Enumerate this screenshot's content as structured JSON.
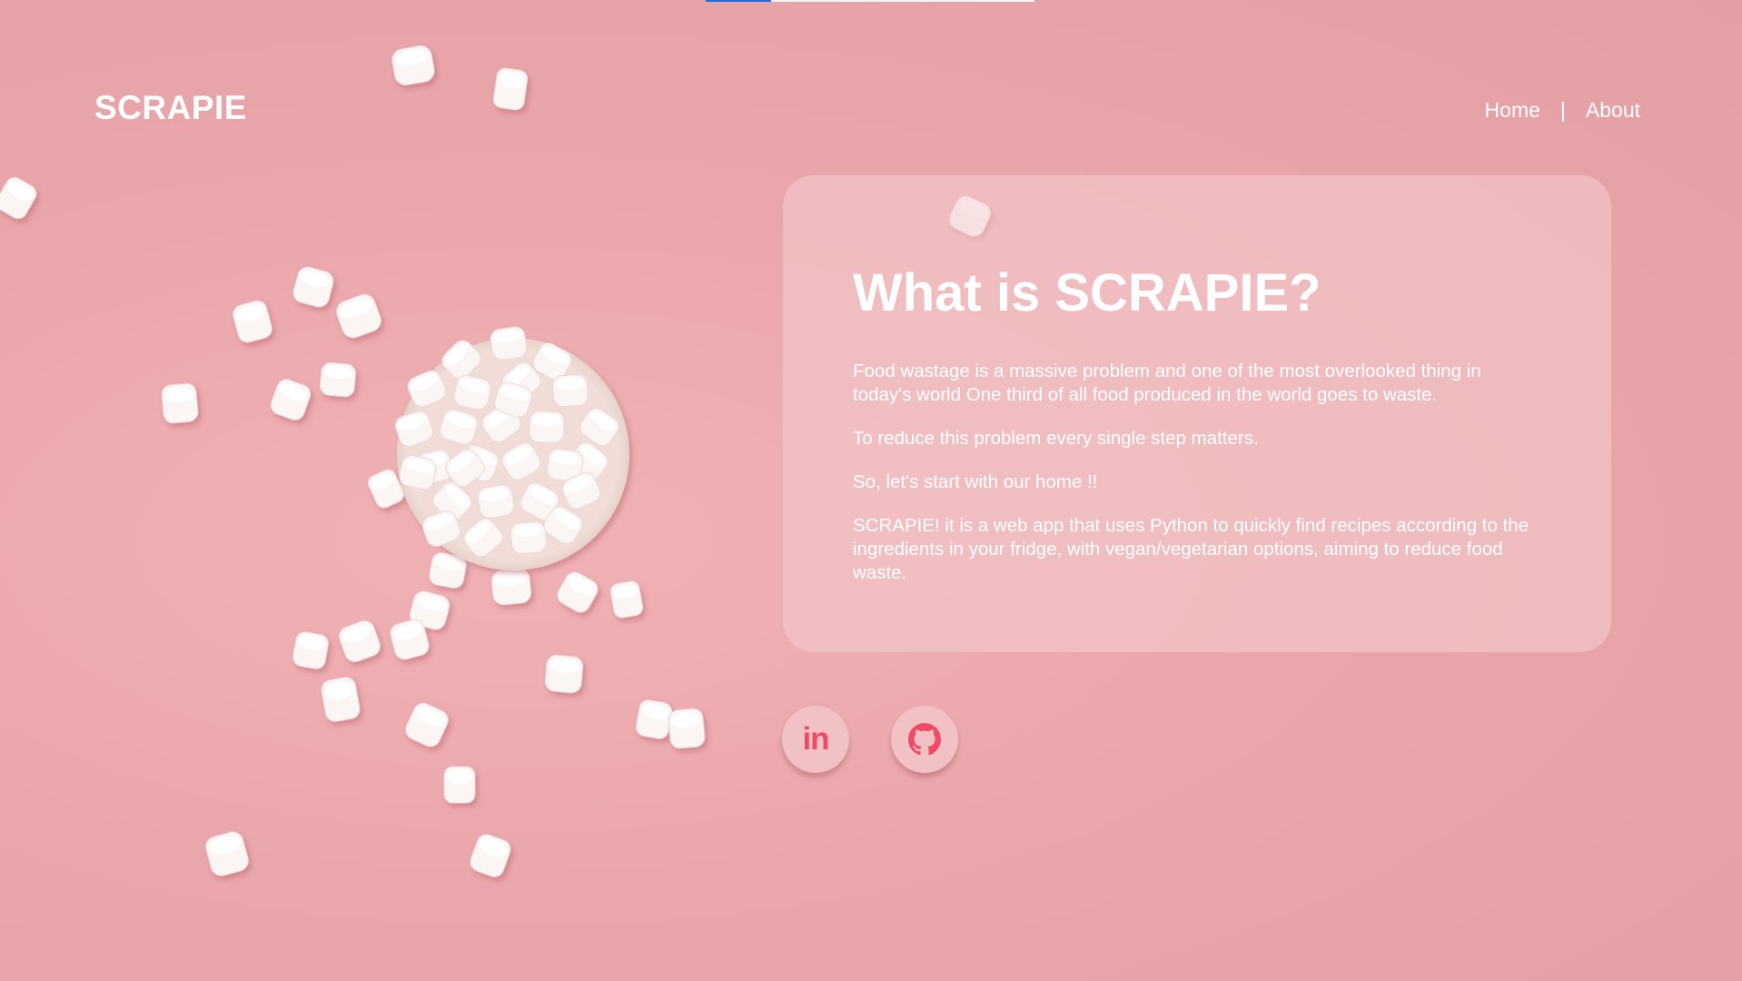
{
  "brand": {
    "name": "SCRAPIE"
  },
  "nav": {
    "home": "Home",
    "separator": "|",
    "about": "About"
  },
  "loading_bar": {
    "progress": 0.2
  },
  "card": {
    "title": "What is SCRAPIE?",
    "paragraphs": [
      "Food wastage is a massive problem and one of the most overlooked thing in today's world One third of all food produced in the world goes to waste.",
      "To reduce this problem every single step matters.",
      "So, let's start with our home !!",
      "SCRAPIE! it is a web app that uses Python to quickly find recipes according to the ingredients in your fridge, with vegan/vegetarian options, aiming to reduce food waste."
    ]
  },
  "social": {
    "linkedin_text": "in",
    "linkedin_icon": "linkedin-icon",
    "github_icon": "github-icon"
  },
  "colors": {
    "background": "#eaa7ab",
    "card": "#f4cdcf",
    "icon_accent": "#ef4a66",
    "loader": "#1a6fd6"
  }
}
